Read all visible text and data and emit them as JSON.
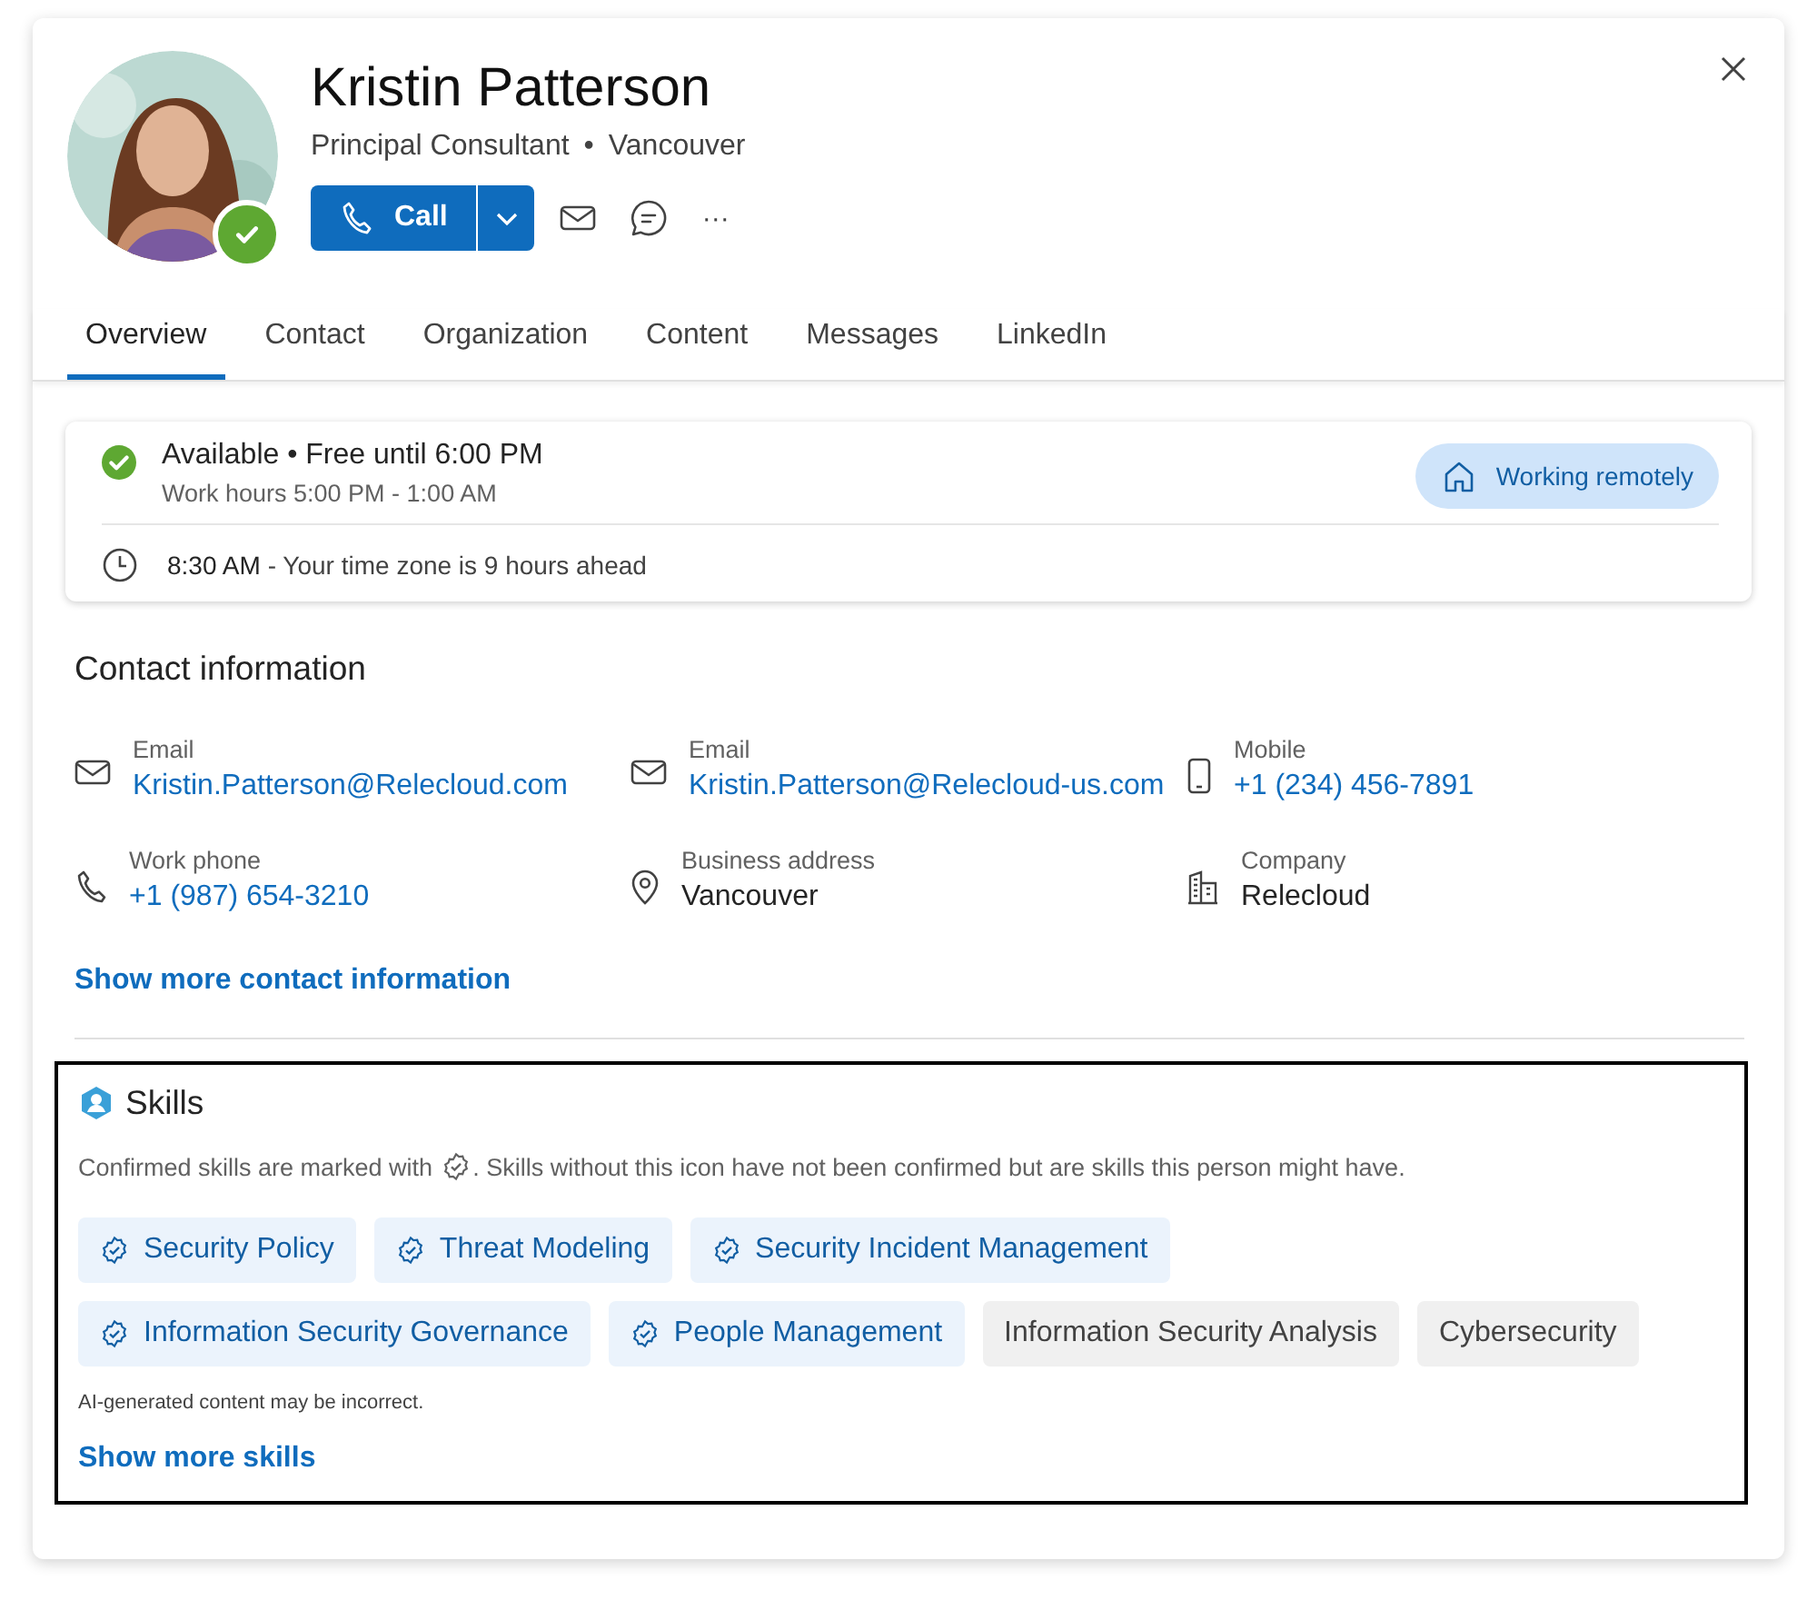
{
  "profile": {
    "name": "Kristin Patterson",
    "title": "Principal Consultant",
    "separator": "•",
    "location": "Vancouver",
    "available": true
  },
  "actions": {
    "call": "Call",
    "more": "···"
  },
  "tabs": [
    {
      "label": "Overview",
      "selected": true
    },
    {
      "label": "Contact",
      "selected": false
    },
    {
      "label": "Organization",
      "selected": false
    },
    {
      "label": "Content",
      "selected": false
    },
    {
      "label": "Messages",
      "selected": false
    },
    {
      "label": "LinkedIn",
      "selected": false
    }
  ],
  "status_card": {
    "available": true,
    "status": "Available • Free until 6:00 PM",
    "work_hours": "Work hours 5:00 PM - 1:00 AM",
    "badge": "Working remotely",
    "local_time": "8:30 AM",
    "time_note": "- Your time zone is 9 hours ahead"
  },
  "contact": {
    "heading": "Contact information",
    "items": [
      {
        "kind": "email",
        "label": "Email",
        "value": "Kristin.Patterson@Relecloud.com",
        "link": true
      },
      {
        "kind": "email",
        "label": "Email",
        "value": "Kristin.Patterson@Relecloud-us.com",
        "link": true
      },
      {
        "kind": "mobile",
        "label": "Mobile",
        "value": "+1 (234) 456-7891",
        "link": true
      },
      {
        "kind": "phone",
        "label": "Work phone",
        "value": "+1 (987) 654-3210",
        "link": true
      },
      {
        "kind": "address",
        "label": "Business address",
        "value": "Vancouver",
        "link": false
      },
      {
        "kind": "company",
        "label": "Company",
        "value": "Relecloud",
        "link": false
      }
    ],
    "show_more": "Show more contact information"
  },
  "skills": {
    "heading": "Skills",
    "note_before": "Confirmed skills are marked with",
    "note_after": ". Skills without this icon have not been confirmed but are skills this person might have.",
    "items": [
      {
        "label": "Security Policy",
        "confirmed": true
      },
      {
        "label": "Threat Modeling",
        "confirmed": true
      },
      {
        "label": "Security Incident Management",
        "confirmed": true
      },
      {
        "label": "Information Security Governance",
        "confirmed": true
      },
      {
        "label": "People Management",
        "confirmed": true
      },
      {
        "label": "Information Security Analysis",
        "confirmed": false
      },
      {
        "label": "Cybersecurity",
        "confirmed": false
      }
    ],
    "disclaimer": "AI-generated content may be incorrect.",
    "show_more": "Show more skills"
  }
}
